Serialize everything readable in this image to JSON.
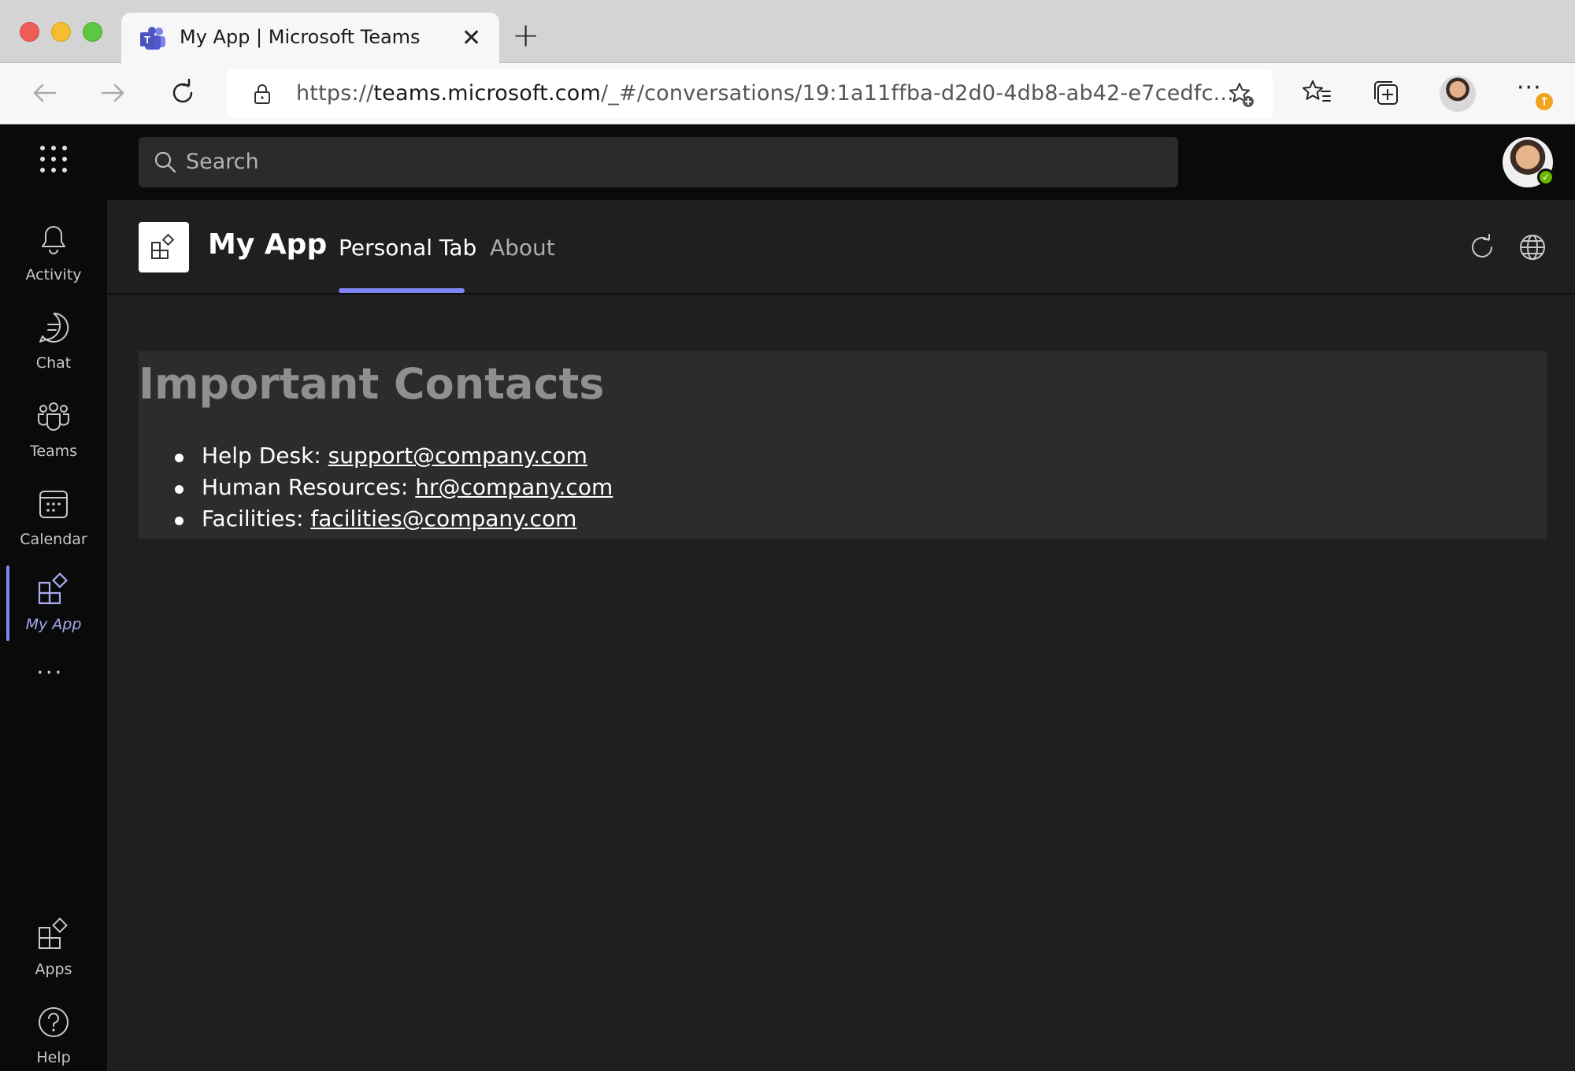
{
  "browser": {
    "tab_title": "My App | Microsoft Teams",
    "url_prefix": "https://",
    "url_host": "teams.microsoft.com",
    "url_path": "/_#/conversations/19:1a11ffba-d2d0-4db8-ab42-e7cedfc..."
  },
  "teams": {
    "search_placeholder": "Search",
    "rail": [
      {
        "label": "Activity",
        "icon": "bell-icon"
      },
      {
        "label": "Chat",
        "icon": "chat-icon"
      },
      {
        "label": "Teams",
        "icon": "teams-icon"
      },
      {
        "label": "Calendar",
        "icon": "calendar-icon"
      },
      {
        "label": "My App",
        "icon": "app-icon"
      },
      {
        "label": "Apps",
        "icon": "apps-icon"
      },
      {
        "label": "Help",
        "icon": "help-icon"
      }
    ]
  },
  "app": {
    "name": "My App",
    "tabs": [
      {
        "label": "Personal Tab",
        "active": true
      },
      {
        "label": "About",
        "active": false
      }
    ]
  },
  "content": {
    "title": "Important Contacts",
    "contacts": [
      {
        "label": "Help Desk: ",
        "email": "support@company.com"
      },
      {
        "label": "Human Resources: ",
        "email": "hr@company.com"
      },
      {
        "label": "Facilities: ",
        "email": "facilities@company.com"
      }
    ]
  },
  "colors": {
    "accent": "#7f85f5",
    "rail_bg": "#0a0a0a",
    "content_bg": "#1f1f1f",
    "panel_bg": "#2c2c2f"
  }
}
